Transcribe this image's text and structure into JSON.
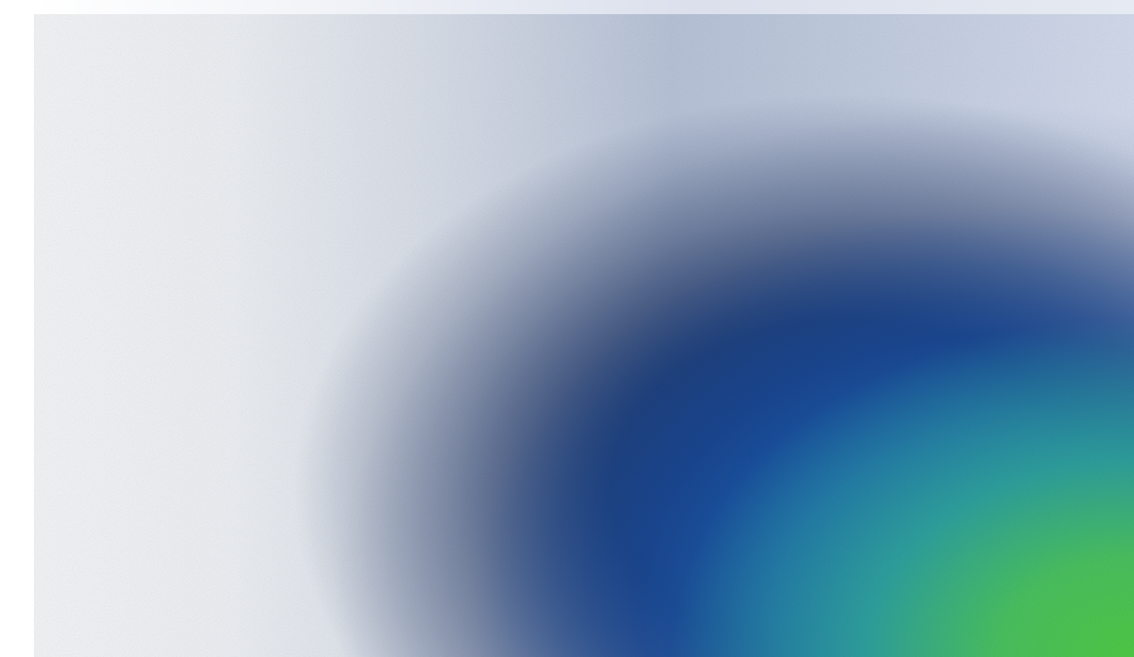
{
  "screen": {
    "type": "decorative-gradient-panel",
    "background": "#ffffff",
    "panel_colors": [
      "#f2f4f8",
      "#d7dde8",
      "#12387a",
      "#1e70be",
      "#34b496",
      "#4fcb45"
    ]
  }
}
